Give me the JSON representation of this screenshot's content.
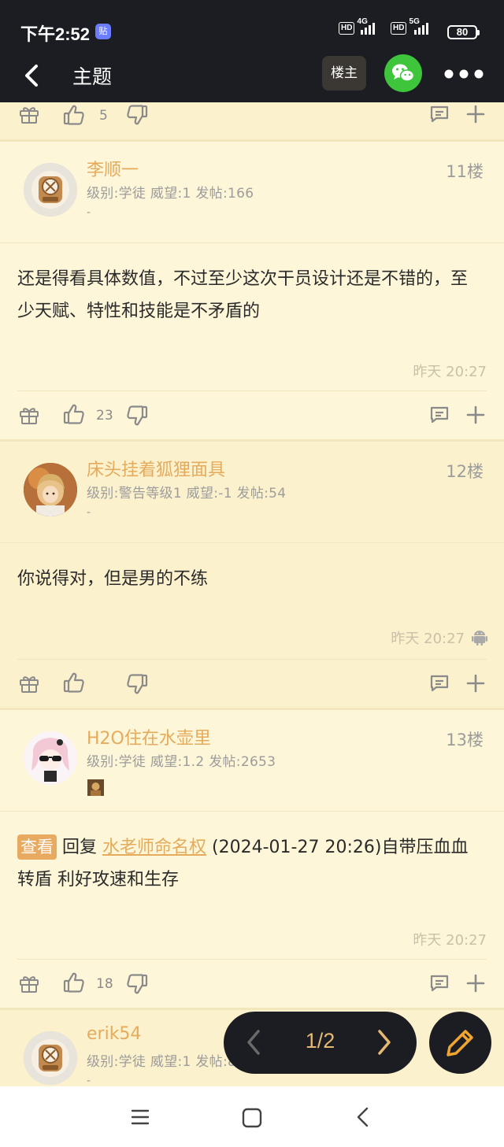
{
  "status_bar": {
    "time": "下午2:52",
    "badge": "贴",
    "net1": "4G",
    "net2": "5G",
    "hd": "HD",
    "battery": "80"
  },
  "nav": {
    "title": "主题",
    "op_button": "楼主"
  },
  "prev_post_actions": {
    "likes": "5"
  },
  "posts": [
    {
      "username": "李顺一",
      "meta": "级别:学徒 威望:1 发帖:166",
      "dash": "-",
      "floor": "11楼",
      "text": "还是得看具体数值，不过至少这次干员设计还是不错的，至少天赋、特性和技能是不矛盾的",
      "timestamp": "昨天 20:27",
      "likes": "23"
    },
    {
      "username": "床头挂着狐狸面具",
      "meta": "级别:警告等级1 威望:-1 发帖:54",
      "dash": "-",
      "floor": "12楼",
      "text": "你说得对，但是男的不练",
      "timestamp": "昨天 20:27",
      "likes": ""
    },
    {
      "username": "H2O住在水壶里",
      "meta": "级别:学徒 威望:1.2 发帖:2653",
      "floor": "13楼",
      "view_chip": "查看",
      "reply_prefix": "回复",
      "reply_user": "水老师命名权",
      "reply_rest": "(2024-01-27 20:26)自带压血血转盾 利好攻速和生存",
      "timestamp": "昨天 20:27",
      "likes": "18"
    },
    {
      "username": "erik54",
      "meta": "级别:学徒 威望:1 发帖:81",
      "dash": "-"
    }
  ],
  "pager": {
    "page": "1/2"
  },
  "colors": {
    "accent": "#e5ab5c",
    "background": "#fdf6d8",
    "dark": "#1b1d22",
    "wechat": "#3ec53b"
  }
}
